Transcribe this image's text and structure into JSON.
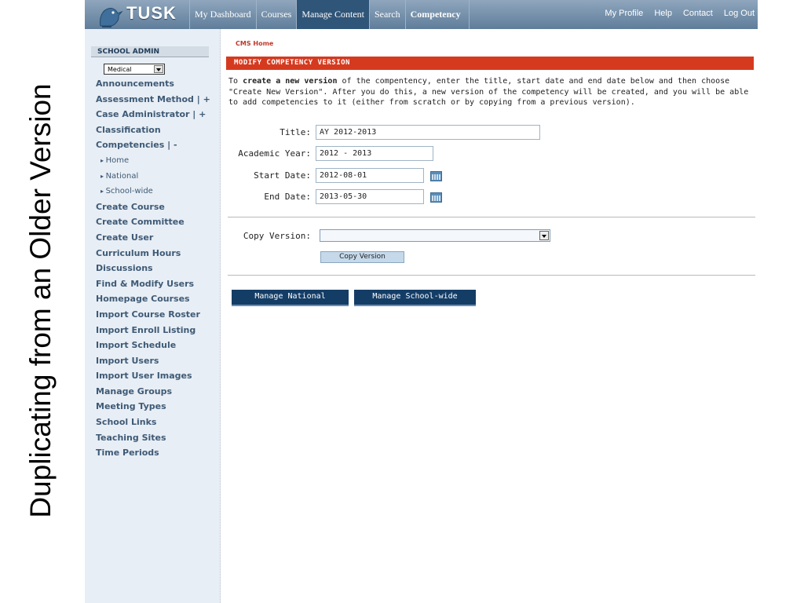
{
  "slide": {
    "caption": "Duplicating from an Older Version"
  },
  "topbar": {
    "logo_text": "TUSK",
    "tabs": [
      {
        "label": "My Dashboard"
      },
      {
        "label": "Courses"
      },
      {
        "label": "Manage Content"
      },
      {
        "label": "Search"
      },
      {
        "label": "Competency"
      }
    ],
    "active_tab": "Manage Content",
    "util_links": [
      "My Profile",
      "Help",
      "Contact",
      "Log Out"
    ]
  },
  "sidebar": {
    "header": "SCHOOL ADMIN",
    "school_select": "Medical",
    "items": [
      {
        "label": "Announcements"
      },
      {
        "label": "Assessment Method  | +"
      },
      {
        "label": "Case Administrator | +"
      },
      {
        "label": "Classification"
      },
      {
        "label": "Competencies  | -"
      },
      {
        "label": "Home",
        "sub": true
      },
      {
        "label": "National",
        "sub": true
      },
      {
        "label": "School-wide",
        "sub": true
      },
      {
        "label": "Create Course"
      },
      {
        "label": "Create Committee"
      },
      {
        "label": "Create User"
      },
      {
        "label": "Curriculum Hours"
      },
      {
        "label": "Discussions"
      },
      {
        "label": "Find & Modify Users"
      },
      {
        "label": "Homepage Courses"
      },
      {
        "label": "Import Course Roster"
      },
      {
        "label": "Import Enroll Listing"
      },
      {
        "label": "Import Schedule"
      },
      {
        "label": "Import Users"
      },
      {
        "label": "Import User Images"
      },
      {
        "label": "Manage Groups"
      },
      {
        "label": "Meeting Types"
      },
      {
        "label": "School Links"
      },
      {
        "label": "Teaching Sites"
      },
      {
        "label": "Time Periods"
      }
    ]
  },
  "main": {
    "breadcrumb": "CMS Home",
    "section_title": "MODIFY COMPETENCY VERSION",
    "intro": {
      "part1": "To ",
      "bold1": "create a new version",
      "part2": " of the compentency, enter the title, start date and end date below and then choose \"Create New Version\".  After you do this, a new version of the competency will be created, and you will be able to add competencies to it (either from scratch or by copying from a previous version)."
    },
    "form": {
      "title_label": "Title:",
      "title_value": "AY 2012-2013",
      "year_label": "Academic Year:",
      "year_value": "2012 - 2013",
      "start_label": "Start Date:",
      "start_value": "2012-08-01",
      "end_label": "End Date:",
      "end_value": "2013-05-30"
    },
    "copy": {
      "label": "Copy Version:",
      "select_value": "",
      "button": "Copy Version"
    },
    "buttons": {
      "national": "Manage National",
      "school": "Manage School-wide"
    }
  },
  "colors": {
    "nav_bar": "#6f8cab",
    "nav_active": "#2f5578",
    "section_bar": "#d53a1f",
    "sidebar_bg": "#e8eef5",
    "button_dark": "#143d66"
  },
  "icons": [
    "calendar-icon",
    "dropdown-arrow-icon",
    "tusk-logo-icon"
  ]
}
